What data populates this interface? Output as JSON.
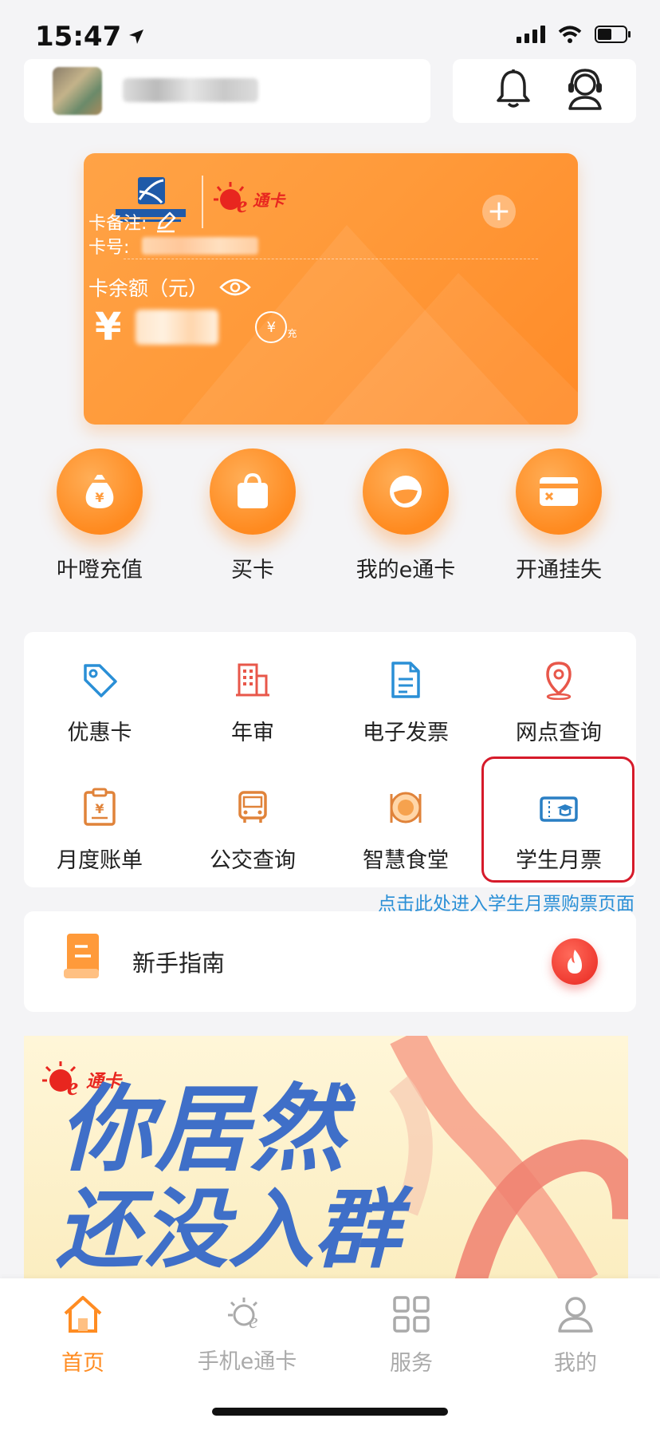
{
  "status": {
    "time": "15:47"
  },
  "card": {
    "note_label": "卡备注:",
    "number_label": "卡号:",
    "balance_label": "卡余额（元）",
    "currency": "¥",
    "recharge_icon_text": "充"
  },
  "quick_actions": [
    {
      "label": "叶噔充值",
      "icon": "money-bag-icon"
    },
    {
      "label": "买卡",
      "icon": "shopping-bag-icon"
    },
    {
      "label": "我的e通卡",
      "icon": "card-face-icon"
    },
    {
      "label": "开通挂失",
      "icon": "card-cancel-icon"
    }
  ],
  "services": [
    {
      "label": "优惠卡",
      "icon": "tag-icon"
    },
    {
      "label": "年审",
      "icon": "building-icon"
    },
    {
      "label": "电子发票",
      "icon": "invoice-icon"
    },
    {
      "label": "网点查询",
      "icon": "location-icon"
    },
    {
      "label": "月度账单",
      "icon": "bill-icon"
    },
    {
      "label": "公交查询",
      "icon": "bus-icon"
    },
    {
      "label": "智慧食堂",
      "icon": "dining-icon"
    },
    {
      "label": "学生月票",
      "icon": "student-ticket-icon"
    }
  ],
  "hint_text": "点击此处进入学生月票购票页面",
  "guide": {
    "label": "新手指南"
  },
  "banner": {
    "brand": "通卡",
    "line1": "你居然",
    "line2": "还没入群"
  },
  "tabbar": [
    {
      "label": "首页",
      "active": true
    },
    {
      "label": "手机e通卡",
      "active": false
    },
    {
      "label": "服务",
      "active": false
    },
    {
      "label": "我的",
      "active": false
    }
  ],
  "colors": {
    "accent": "#ff8c22",
    "highlight": "#d61a2a",
    "hint": "#2a8fd6"
  }
}
